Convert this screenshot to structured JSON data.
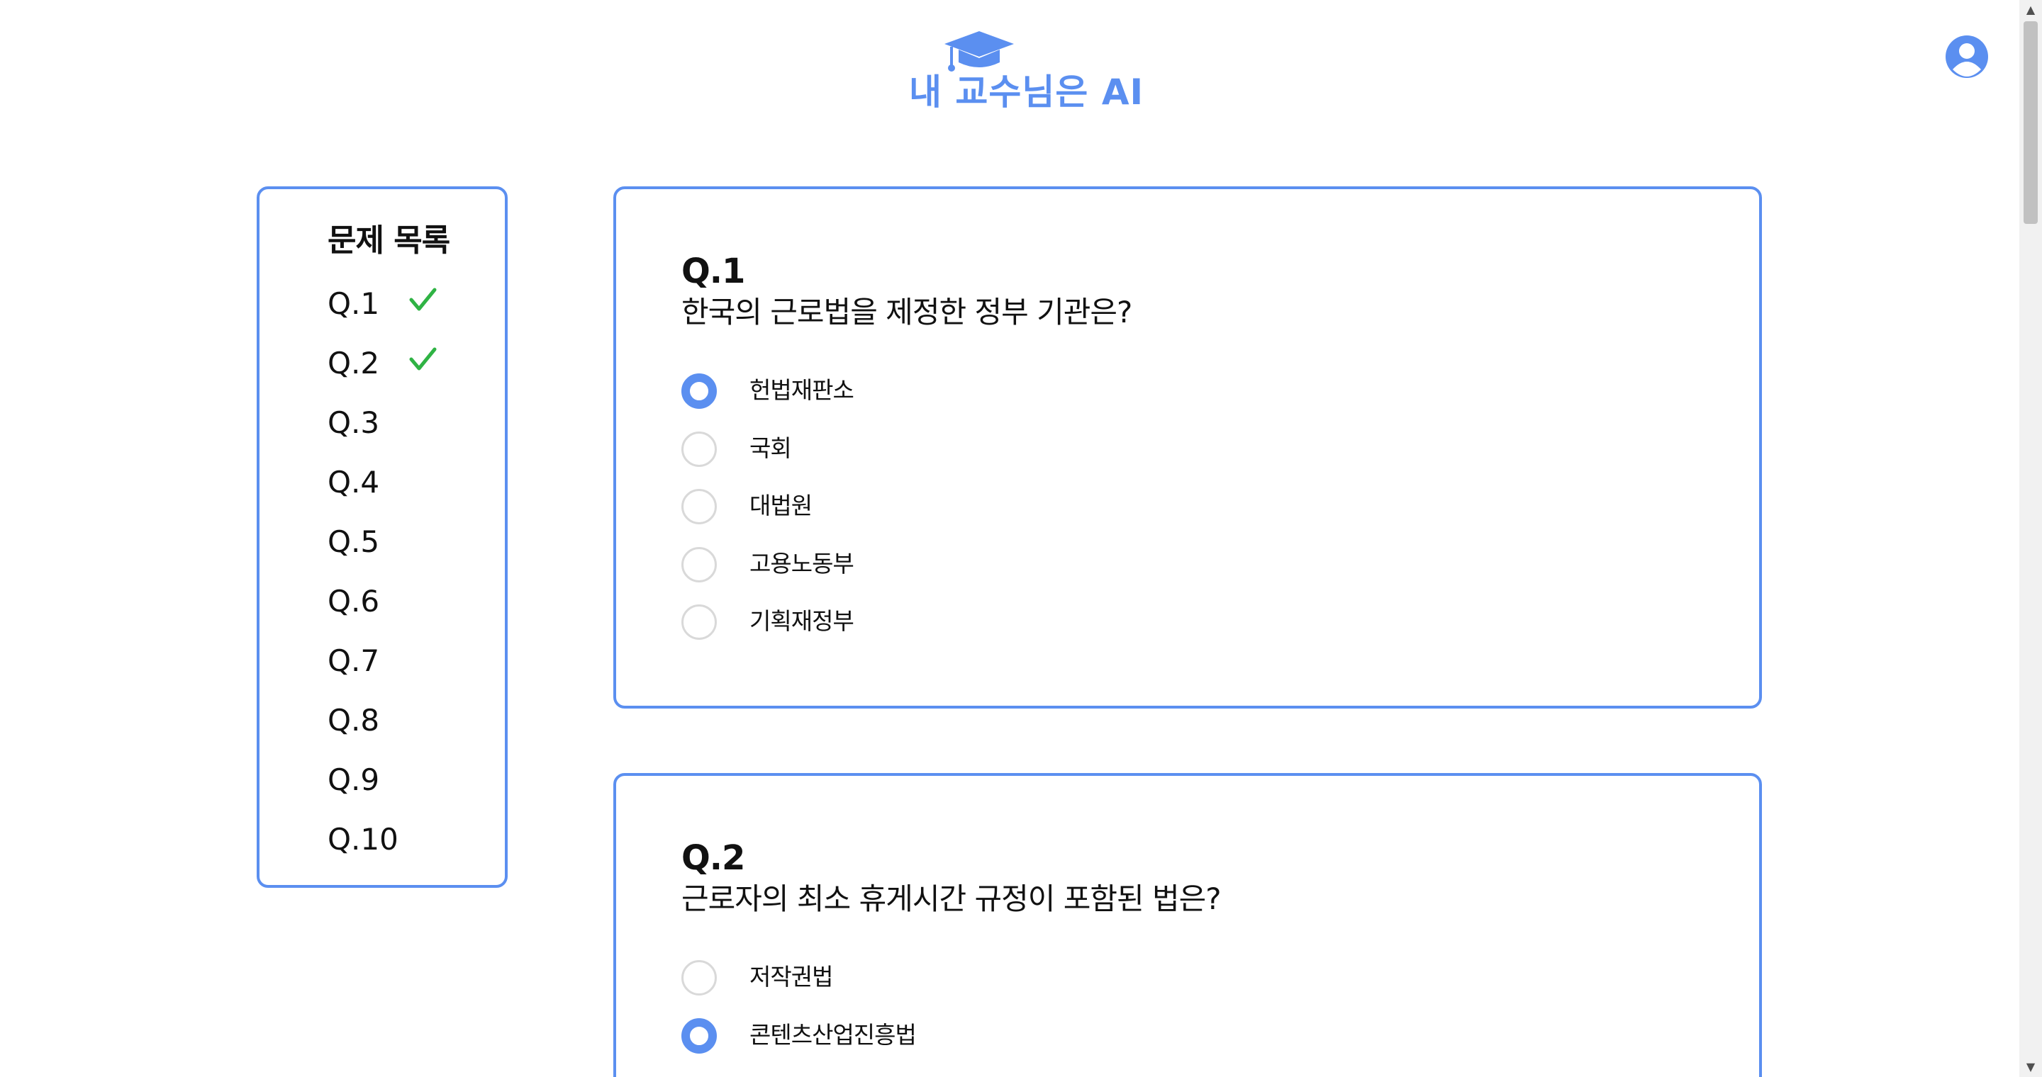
{
  "header": {
    "logo_text": "내 교수님은 AI",
    "logo_icon": "graduation-cap-icon",
    "profile_icon": "user-circle-icon"
  },
  "colors": {
    "accent": "#5b8ff0",
    "check": "#2fb344",
    "radio_border": "#d9d9d9"
  },
  "sidebar": {
    "title": "문제 목록",
    "items": [
      {
        "label": "Q.1",
        "answered": true
      },
      {
        "label": "Q.2",
        "answered": true
      },
      {
        "label": "Q.3",
        "answered": false
      },
      {
        "label": "Q.4",
        "answered": false
      },
      {
        "label": "Q.5",
        "answered": false
      },
      {
        "label": "Q.6",
        "answered": false
      },
      {
        "label": "Q.7",
        "answered": false
      },
      {
        "label": "Q.8",
        "answered": false
      },
      {
        "label": "Q.9",
        "answered": false
      },
      {
        "label": "Q.10",
        "answered": false
      }
    ]
  },
  "questions": [
    {
      "number": "Q.1",
      "text": "한국의 근로법을 제정한 정부 기관은?",
      "options": [
        {
          "label": "헌법재판소",
          "selected": true
        },
        {
          "label": "국회",
          "selected": false
        },
        {
          "label": "대법원",
          "selected": false
        },
        {
          "label": "고용노동부",
          "selected": false
        },
        {
          "label": "기획재정부",
          "selected": false
        }
      ]
    },
    {
      "number": "Q.2",
      "text": "근로자의 최소 휴게시간 규정이 포함된 법은?",
      "options": [
        {
          "label": "저작권법",
          "selected": false
        },
        {
          "label": "콘텐츠산업진흥법",
          "selected": true
        }
      ]
    }
  ]
}
